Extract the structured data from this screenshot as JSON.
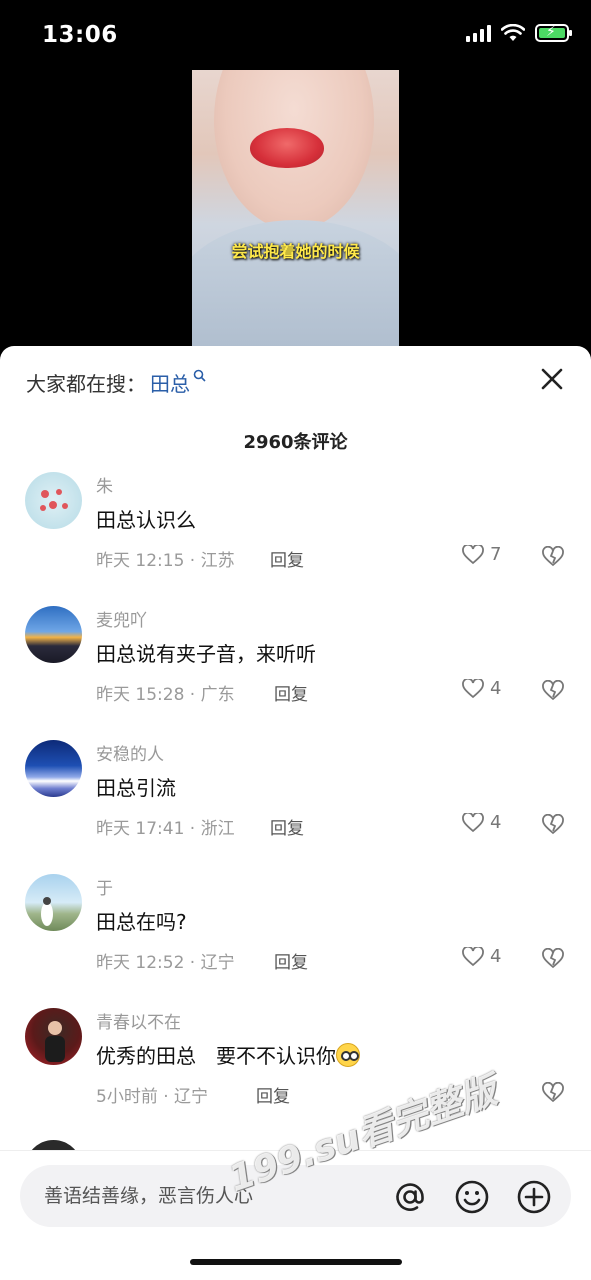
{
  "status_bar": {
    "time": "13:06"
  },
  "video": {
    "caption": "尝试抱着她的时候"
  },
  "search_suggestion": {
    "label": "大家都在搜：",
    "term": "田总"
  },
  "comment_count": "2960条评论",
  "comments": [
    {
      "user": "朱",
      "text": "田总认识么",
      "meta": "昨天 12:15 · 江苏",
      "reply": "回复",
      "likes": "7"
    },
    {
      "user": "麦兜吖",
      "text": "田总说有夹子音，来听听",
      "meta": "昨天 15:28 · 广东",
      "reply": "回复",
      "likes": "4"
    },
    {
      "user": "安稳的人",
      "text": "田总引流",
      "meta": "昨天 17:41 · 浙江",
      "reply": "回复",
      "likes": "4"
    },
    {
      "user": "于",
      "text": "田总在吗?",
      "meta": "昨天 12:52 · 辽宁",
      "reply": "回复",
      "likes": "4"
    },
    {
      "user": "青春以不在",
      "text": "优秀的田总　要不不认识你",
      "meta": "5小时前 · 辽宁",
      "reply": "回复",
      "likes": ""
    }
  ],
  "input": {
    "placeholder": "善语结善缘，恶言伤人心"
  },
  "watermark": "199.su看完整版",
  "colors": {
    "accent_link": "#2a5ea8",
    "battery": "#4cd964"
  },
  "icons": [
    "signal-icon",
    "wifi-icon",
    "battery-charging-icon",
    "search-icon",
    "close-icon",
    "heart-icon",
    "broken-heart-icon",
    "at-icon",
    "emoji-icon",
    "plus-icon"
  ]
}
